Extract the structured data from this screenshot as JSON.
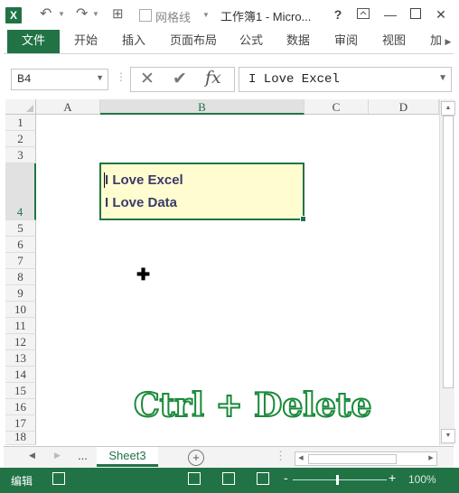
{
  "titlebar": {
    "logo_letter": "X",
    "undo_icon": "↶",
    "redo_icon": "↷",
    "gridlines_label": "网格线",
    "title": "工作簿1 - Micro...",
    "help": "?",
    "minimize": "—",
    "close": "✕"
  },
  "ribbon": {
    "file": "文件",
    "tabs": [
      "开始",
      "插入",
      "页面布局",
      "公式",
      "数据",
      "审阅",
      "视图",
      "加载"
    ]
  },
  "formula_bar": {
    "name_box": "B4",
    "formula": "I Love Excel",
    "cancel_icon": "✕",
    "enter_icon": "✔",
    "fx_icon": "fx"
  },
  "columns": [
    "A",
    "B",
    "C",
    "D"
  ],
  "rows": [
    "1",
    "2",
    "3",
    "4",
    "5",
    "6",
    "7",
    "8",
    "9",
    "10",
    "11",
    "12",
    "13",
    "14",
    "15",
    "16",
    "17",
    "18"
  ],
  "cell": {
    "line1": "I Love Excel",
    "line2": "I Love Data"
  },
  "overlay_text": "Ctrl + Delete",
  "sheet_tabs": {
    "more": "...",
    "active": "Sheet3",
    "add": "+"
  },
  "status": {
    "mode": "编辑",
    "zoom_minus": "-",
    "zoom_plus": "+",
    "zoom": "100%"
  }
}
